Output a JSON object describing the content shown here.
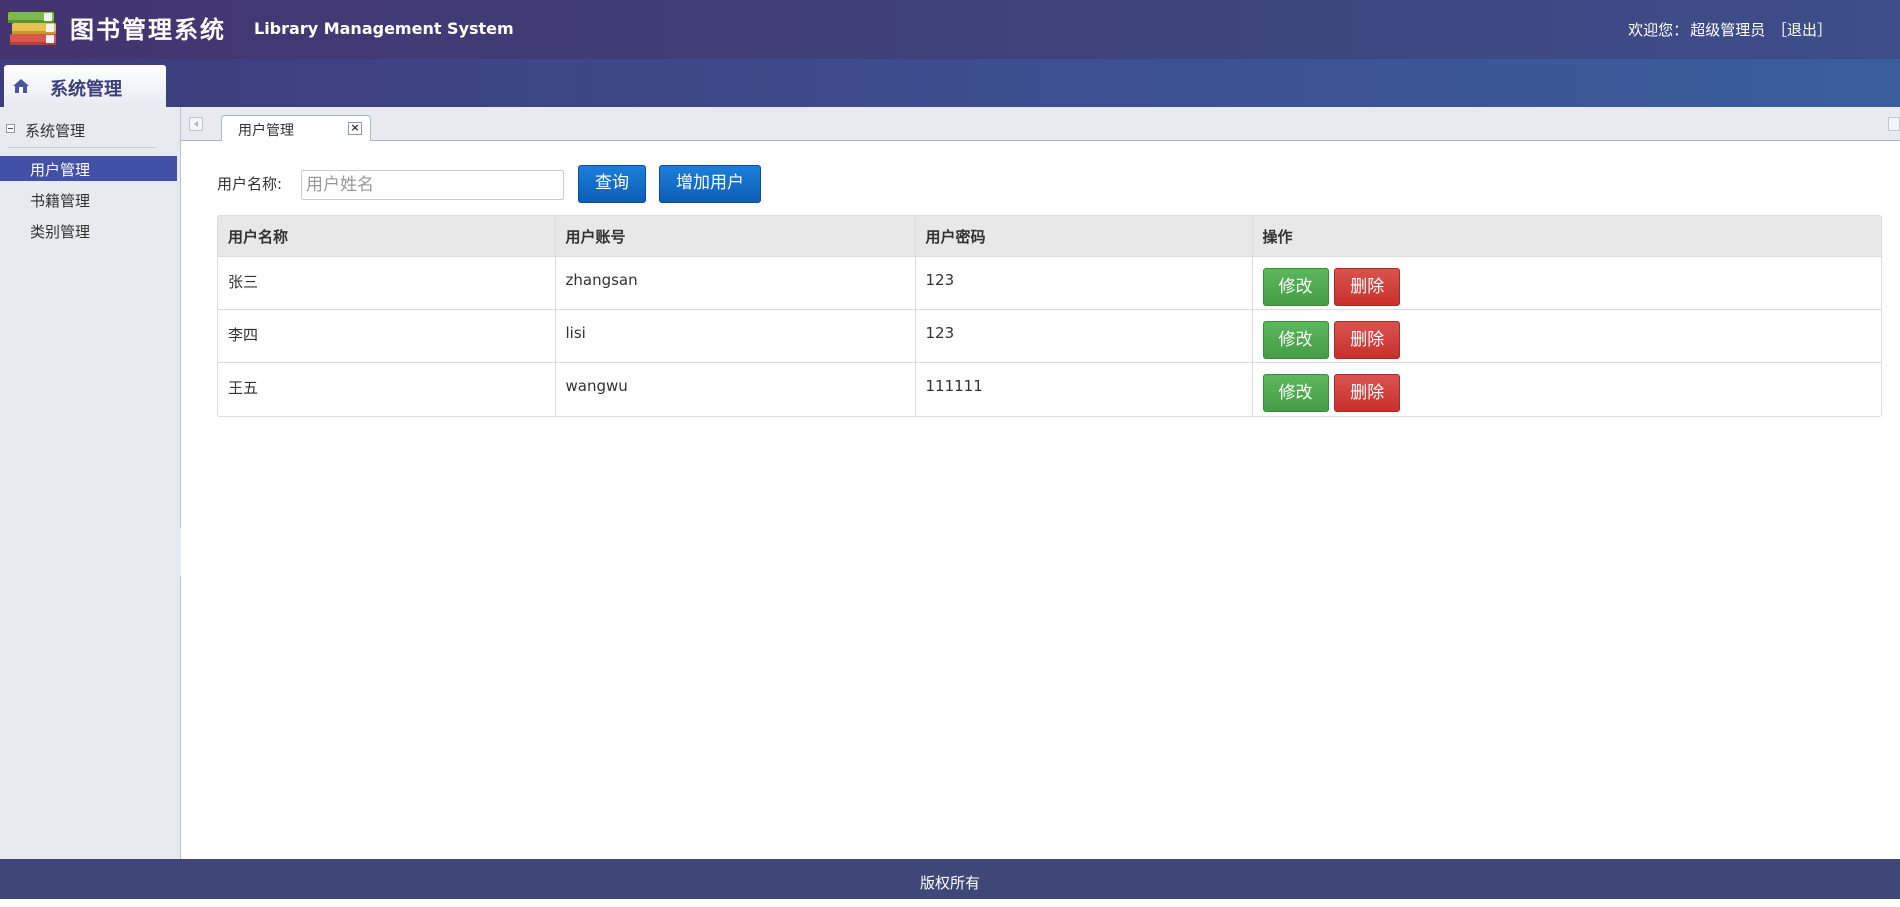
{
  "header": {
    "title": "图书管理系统",
    "subtitle": "Library Management System",
    "welcome_prefix": "欢迎您：",
    "user": "超级管理员",
    "logout": "［退出］"
  },
  "nav": {
    "tab_label": "系统管理"
  },
  "sidebar": {
    "section_label": "系统管理",
    "items": [
      {
        "label": "用户管理"
      },
      {
        "label": "书籍管理"
      },
      {
        "label": "类别管理"
      }
    ]
  },
  "tabs": {
    "active_label": "用户管理",
    "close_symbol": "×"
  },
  "search": {
    "label": "用户名称:",
    "placeholder": "用户姓名",
    "query_button": "查询",
    "add_button": "增加用户"
  },
  "table": {
    "headers": [
      "用户名称",
      "用户账号",
      "用户密码",
      "操作"
    ],
    "rows": [
      {
        "name": "张三",
        "account": "zhangsan",
        "password": "123"
      },
      {
        "name": "李四",
        "account": "lisi",
        "password": "123"
      },
      {
        "name": "王五",
        "account": "wangwu",
        "password": "111111"
      }
    ],
    "edit_label": "修改",
    "delete_label": "删除"
  },
  "footer": {
    "text": "版权所有"
  }
}
